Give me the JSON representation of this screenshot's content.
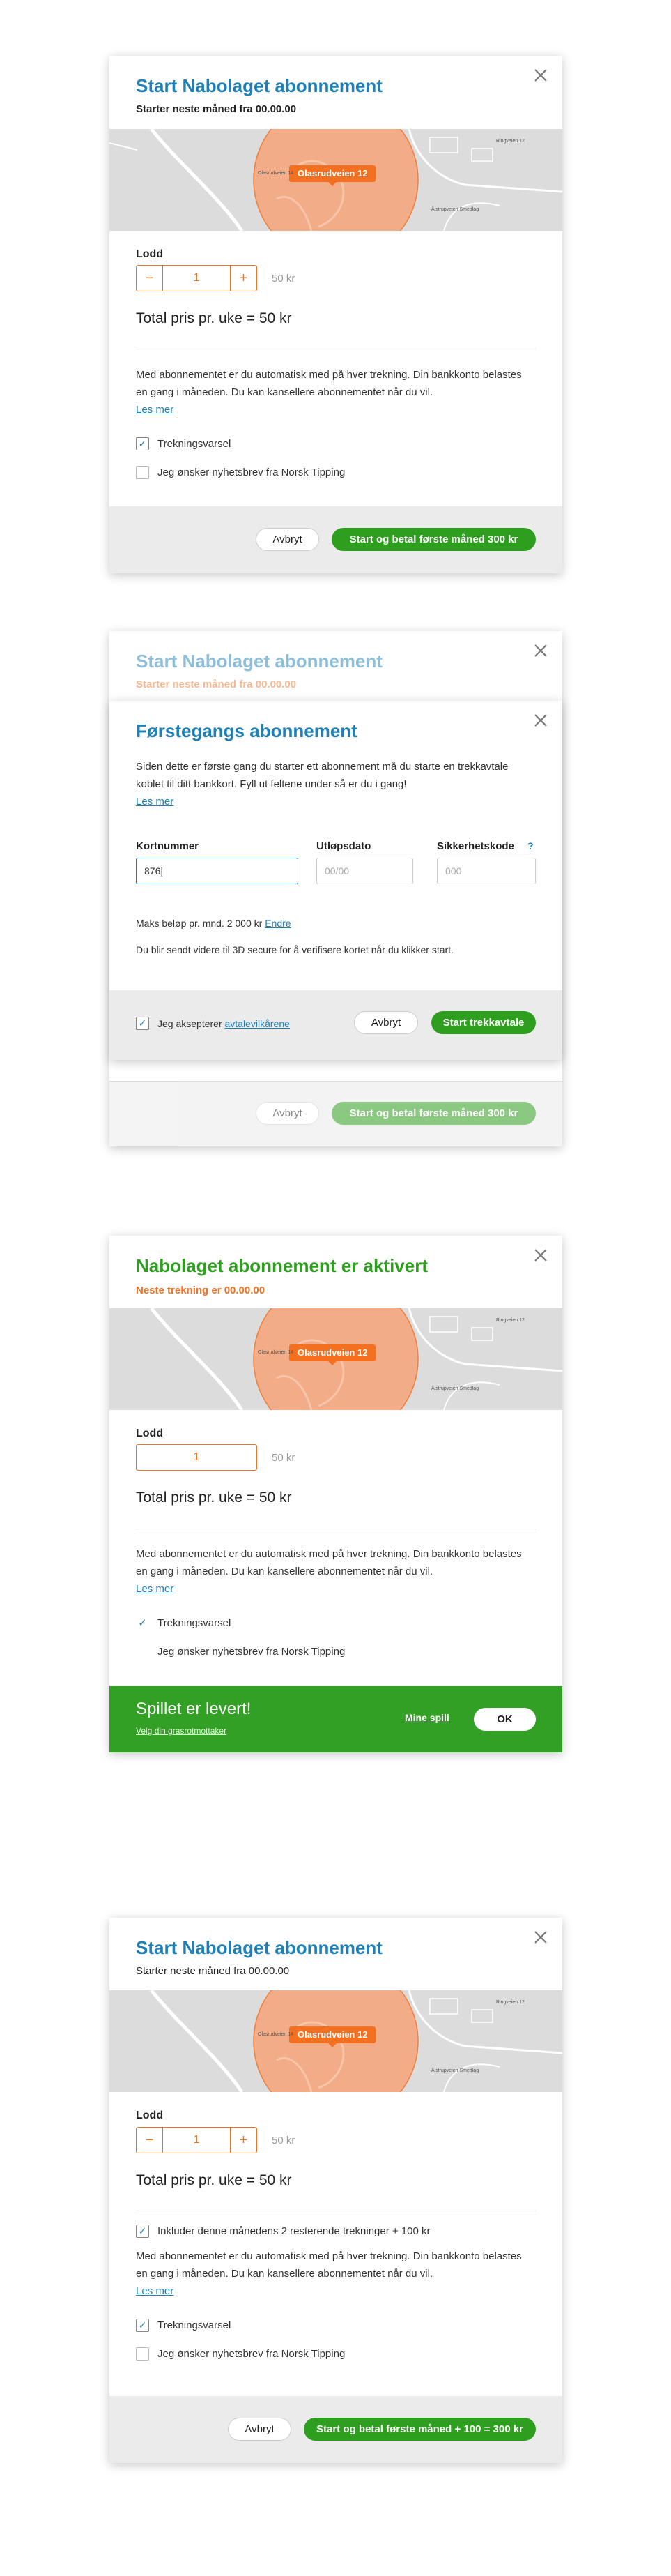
{
  "dialog1": {
    "title": "Start Nabolaget abonnement",
    "subtitle": "Starter neste måned fra 00.00.00",
    "map": {
      "pin_label": "Olasrudveien 12",
      "label_a": "Olasrudveien 14",
      "label_b": "Ringveien 12",
      "label_c": "Ålstrupveien Smedlag"
    },
    "lodd_label": "Lodd",
    "quantity": "1",
    "minus": "−",
    "plus": "+",
    "unit_price": "50 kr",
    "total": "Total pris pr. uke = 50 kr",
    "info": "Med abonnementet er du automatisk med på hver trekning. Din bankkonto belastes en gang i måneden. Du kan kansellere abonnementet når du vil.",
    "read_more": "Les mer",
    "checkbox_draw": "Trekningsvarsel",
    "checkbox_newsletter": "Jeg ønsker nyhetsbrev fra Norsk Tipping",
    "cancel": "Avbryt",
    "confirm": "Start og betal første måned 300 kr"
  },
  "dialog2": {
    "bg_title": "Start Nabolaget abonnement",
    "bg_subtitle": "Starter neste måned fra 00.00.00",
    "bg_cancel": "Avbryt",
    "bg_confirm": "Start og betal første måned 300 kr",
    "modal_title": "Førstegangs abonnement",
    "modal_info": "Siden dette er første gang du starter ett abonnement må du starte en trekkavtale koblet til ditt bankkort. Fyll ut feltene under så er du i gang!",
    "read_more": "Les mer",
    "card_label": "Kortnummer",
    "card_value": "876|",
    "expiry_label": "Utløpsdato",
    "expiry_placeholder": "00/00",
    "cvc_label": "Sikkerhetskode",
    "cvc_help": "?",
    "cvc_placeholder": "000",
    "max_amount": "Maks beløp pr. mnd. 2 000 kr",
    "change": "Endre",
    "secure_info": "Du blir sendt videre til 3D secure for å verifisere kortet når du klikker start.",
    "accept_prefix": "Jeg aksepterer ",
    "accept_link": "avtalevilkårene",
    "cancel": "Avbryt",
    "confirm": "Start trekkavtale"
  },
  "dialog3": {
    "title": "Nabolaget abonnement er aktivert",
    "subtitle": "Neste trekning er 00.00.00",
    "map": {
      "pin_label": "Olasrudveien 12",
      "label_a": "Olasrudveien 14",
      "label_b": "Ringveien 12",
      "label_c": "Ålstrupveien Smedlag"
    },
    "lodd_label": "Lodd",
    "quantity": "1",
    "unit_price": "50 kr",
    "total": "Total pris pr. uke = 50 kr",
    "info": "Med abonnementet er du automatisk med på hver trekning. Din bankkonto belastes en gang i måneden. Du kan kansellere abonnementet når du vil.",
    "read_more": "Les mer",
    "draw_notice": "Trekningsvarsel",
    "newsletter": "Jeg ønsker nyhetsbrev fra Norsk Tipping",
    "delivered": "Spillet er levert!",
    "choose_recipient": "Velg din grasrotmottaker",
    "my_games": "Mine spill",
    "ok": "OK"
  },
  "dialog4": {
    "title": "Start Nabolaget abonnement",
    "subtitle": "Starter neste måned fra 00.00.00",
    "map": {
      "pin_label": "Olasrudveien 12",
      "label_a": "Olasrudveien 14",
      "label_b": "Ringveien 12",
      "label_c": "Ålstrupveien Smedlag"
    },
    "lodd_label": "Lodd",
    "quantity": "1",
    "minus": "−",
    "plus": "+",
    "unit_price": "50 kr",
    "total": "Total pris pr. uke = 50 kr",
    "include_remaining": "Inkluder denne månedens 2 resterende trekninger + 100 kr",
    "info": "Med abonnementet er du automatisk med på hver trekning. Din bankkonto belastes en gang i måneden. Du kan kansellere abonnementet når du vil.",
    "read_more": "Les mer",
    "checkbox_draw": "Trekningsvarsel",
    "checkbox_newsletter": "Jeg ønsker nyhetsbrev fra Norsk Tipping",
    "cancel": "Avbryt",
    "confirm": "Start og betal første måned + 100 = 300 kr"
  },
  "colors": {
    "brand_blue": "#1d80b7",
    "orange": "#f37021",
    "green": "#2e9e1f",
    "bar_green": "#31a024"
  },
  "icons": [
    "close-icon",
    "check-icon",
    "help-icon",
    "map-pin-icon"
  ]
}
